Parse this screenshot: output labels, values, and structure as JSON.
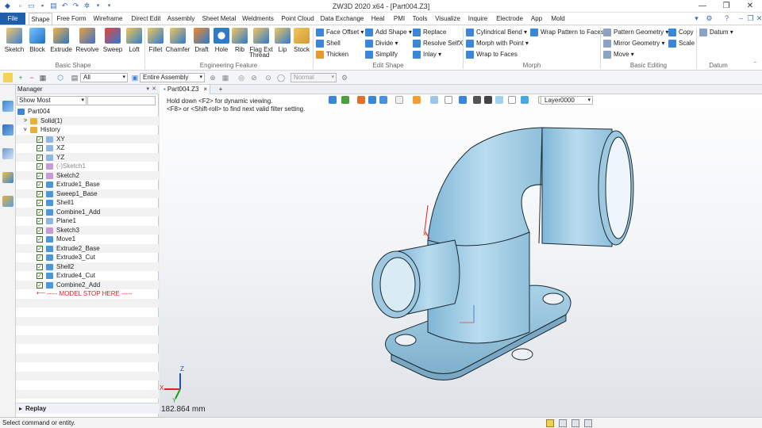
{
  "window": {
    "title": "ZW3D 2020 x64 - [Part004.Z3]"
  },
  "menu": {
    "file": "File",
    "tabs": [
      "Shape",
      "Free Form",
      "Wireframe",
      "Direct Edit",
      "Assembly",
      "Sheet Metal",
      "Weldments",
      "Point Cloud",
      "Data Exchange",
      "Heal",
      "PMI",
      "Tools",
      "Visualize",
      "Inquire",
      "Electrode",
      "App",
      "Mold"
    ]
  },
  "ribbon": {
    "basic_shape": {
      "label": "Basic Shape",
      "items": [
        "Sketch",
        "Block",
        "Extrude",
        "Revolve",
        "Sweep",
        "Loft"
      ]
    },
    "engineering_feature": {
      "label": "Engineering Feature",
      "items": [
        "Fillet",
        "Chamfer",
        "Draft",
        "Hole",
        "Rib",
        "Flag Ext",
        "Lip",
        "Stock"
      ],
      "thread": "Thread"
    },
    "edit_shape": {
      "label": "Edit Shape",
      "col1": [
        "Face Offset",
        "Shell",
        "Thicken"
      ],
      "col2": [
        "Add Shape",
        "Divide",
        "Simplify"
      ],
      "col3": [
        "Replace",
        "Resolve SelfX",
        "Inlay"
      ]
    },
    "morph": {
      "label": "Morph",
      "col1": [
        "Cylindrical Bend",
        "Morph with Point",
        "Wrap to Faces"
      ],
      "col2": [
        "Wrap Pattern to Faces"
      ]
    },
    "basic_editing": {
      "label": "Basic Editing",
      "col1": [
        "Pattern Geometry",
        "Mirror Geometry",
        "Move"
      ],
      "col2": [
        "Copy",
        "Scale"
      ]
    },
    "datum": {
      "label": "Datum",
      "item": "Datum"
    }
  },
  "toolbar": {
    "filter_value": "All",
    "scope_value": "Entire Assembly",
    "mode_value": "Normal"
  },
  "manager": {
    "title": "Manager",
    "filter": "Show Most",
    "tree": [
      {
        "label": "Part004",
        "indent": 0,
        "checkbox": false,
        "icon": "part"
      },
      {
        "label": "Solid(1)",
        "indent": 1,
        "checkbox": false,
        "icon": "folder",
        "expander": ">"
      },
      {
        "label": "History",
        "indent": 1,
        "checkbox": false,
        "icon": "folder",
        "expander": "v"
      },
      {
        "label": "XY",
        "indent": 2,
        "checkbox": true,
        "icon": "plane"
      },
      {
        "label": "XZ",
        "indent": 2,
        "checkbox": true,
        "icon": "plane"
      },
      {
        "label": "YZ",
        "indent": 2,
        "checkbox": true,
        "icon": "plane"
      },
      {
        "label": "(-)Sketch1",
        "indent": 2,
        "checkbox": true,
        "icon": "sketch",
        "muted": true
      },
      {
        "label": "Sketch2",
        "indent": 2,
        "checkbox": true,
        "icon": "sketch"
      },
      {
        "label": "Extrude1_Base",
        "indent": 2,
        "checkbox": true,
        "icon": "feature"
      },
      {
        "label": "Sweep1_Base",
        "indent": 2,
        "checkbox": true,
        "icon": "feature"
      },
      {
        "label": "Shell1",
        "indent": 2,
        "checkbox": true,
        "icon": "feature"
      },
      {
        "label": "Combine1_Add",
        "indent": 2,
        "checkbox": true,
        "icon": "feature"
      },
      {
        "label": "Plane1",
        "indent": 2,
        "checkbox": true,
        "icon": "plane"
      },
      {
        "label": "Sketch3",
        "indent": 2,
        "checkbox": true,
        "icon": "sketch"
      },
      {
        "label": "Move1",
        "indent": 2,
        "checkbox": true,
        "icon": "feature"
      },
      {
        "label": "Extrude2_Base",
        "indent": 2,
        "checkbox": true,
        "icon": "feature"
      },
      {
        "label": "Extrude3_Cut",
        "indent": 2,
        "checkbox": true,
        "icon": "feature"
      },
      {
        "label": "Shell2",
        "indent": 2,
        "checkbox": true,
        "icon": "feature"
      },
      {
        "label": "Extrude4_Cut",
        "indent": 2,
        "checkbox": true,
        "icon": "feature"
      },
      {
        "label": "Combine2_Add",
        "indent": 2,
        "checkbox": true,
        "icon": "feature"
      },
      {
        "label": "----- MODEL STOP HERE -----",
        "indent": 2,
        "checkbox": false,
        "icon": "arrow",
        "stop": true
      }
    ],
    "replay": "Replay"
  },
  "viewport": {
    "tab": "Part004.Z3",
    "tab_close": "×",
    "tab_add": "+",
    "hint1": "Hold down <F2> for dynamic viewing.",
    "hint2": "<F8> or <Shift-roll> to find next valid filter setting.",
    "layer": "Layer0000",
    "measure": "182.864 mm",
    "axis_x": "X",
    "axis_y": "Y",
    "axis_z": "Z"
  },
  "status": {
    "text": "Select command or entity."
  },
  "colors": {
    "accent": "#1f5fa9",
    "part_fill": "#a8d0e6",
    "part_edge": "#1a2a33",
    "stop_marker": "#e02020"
  }
}
